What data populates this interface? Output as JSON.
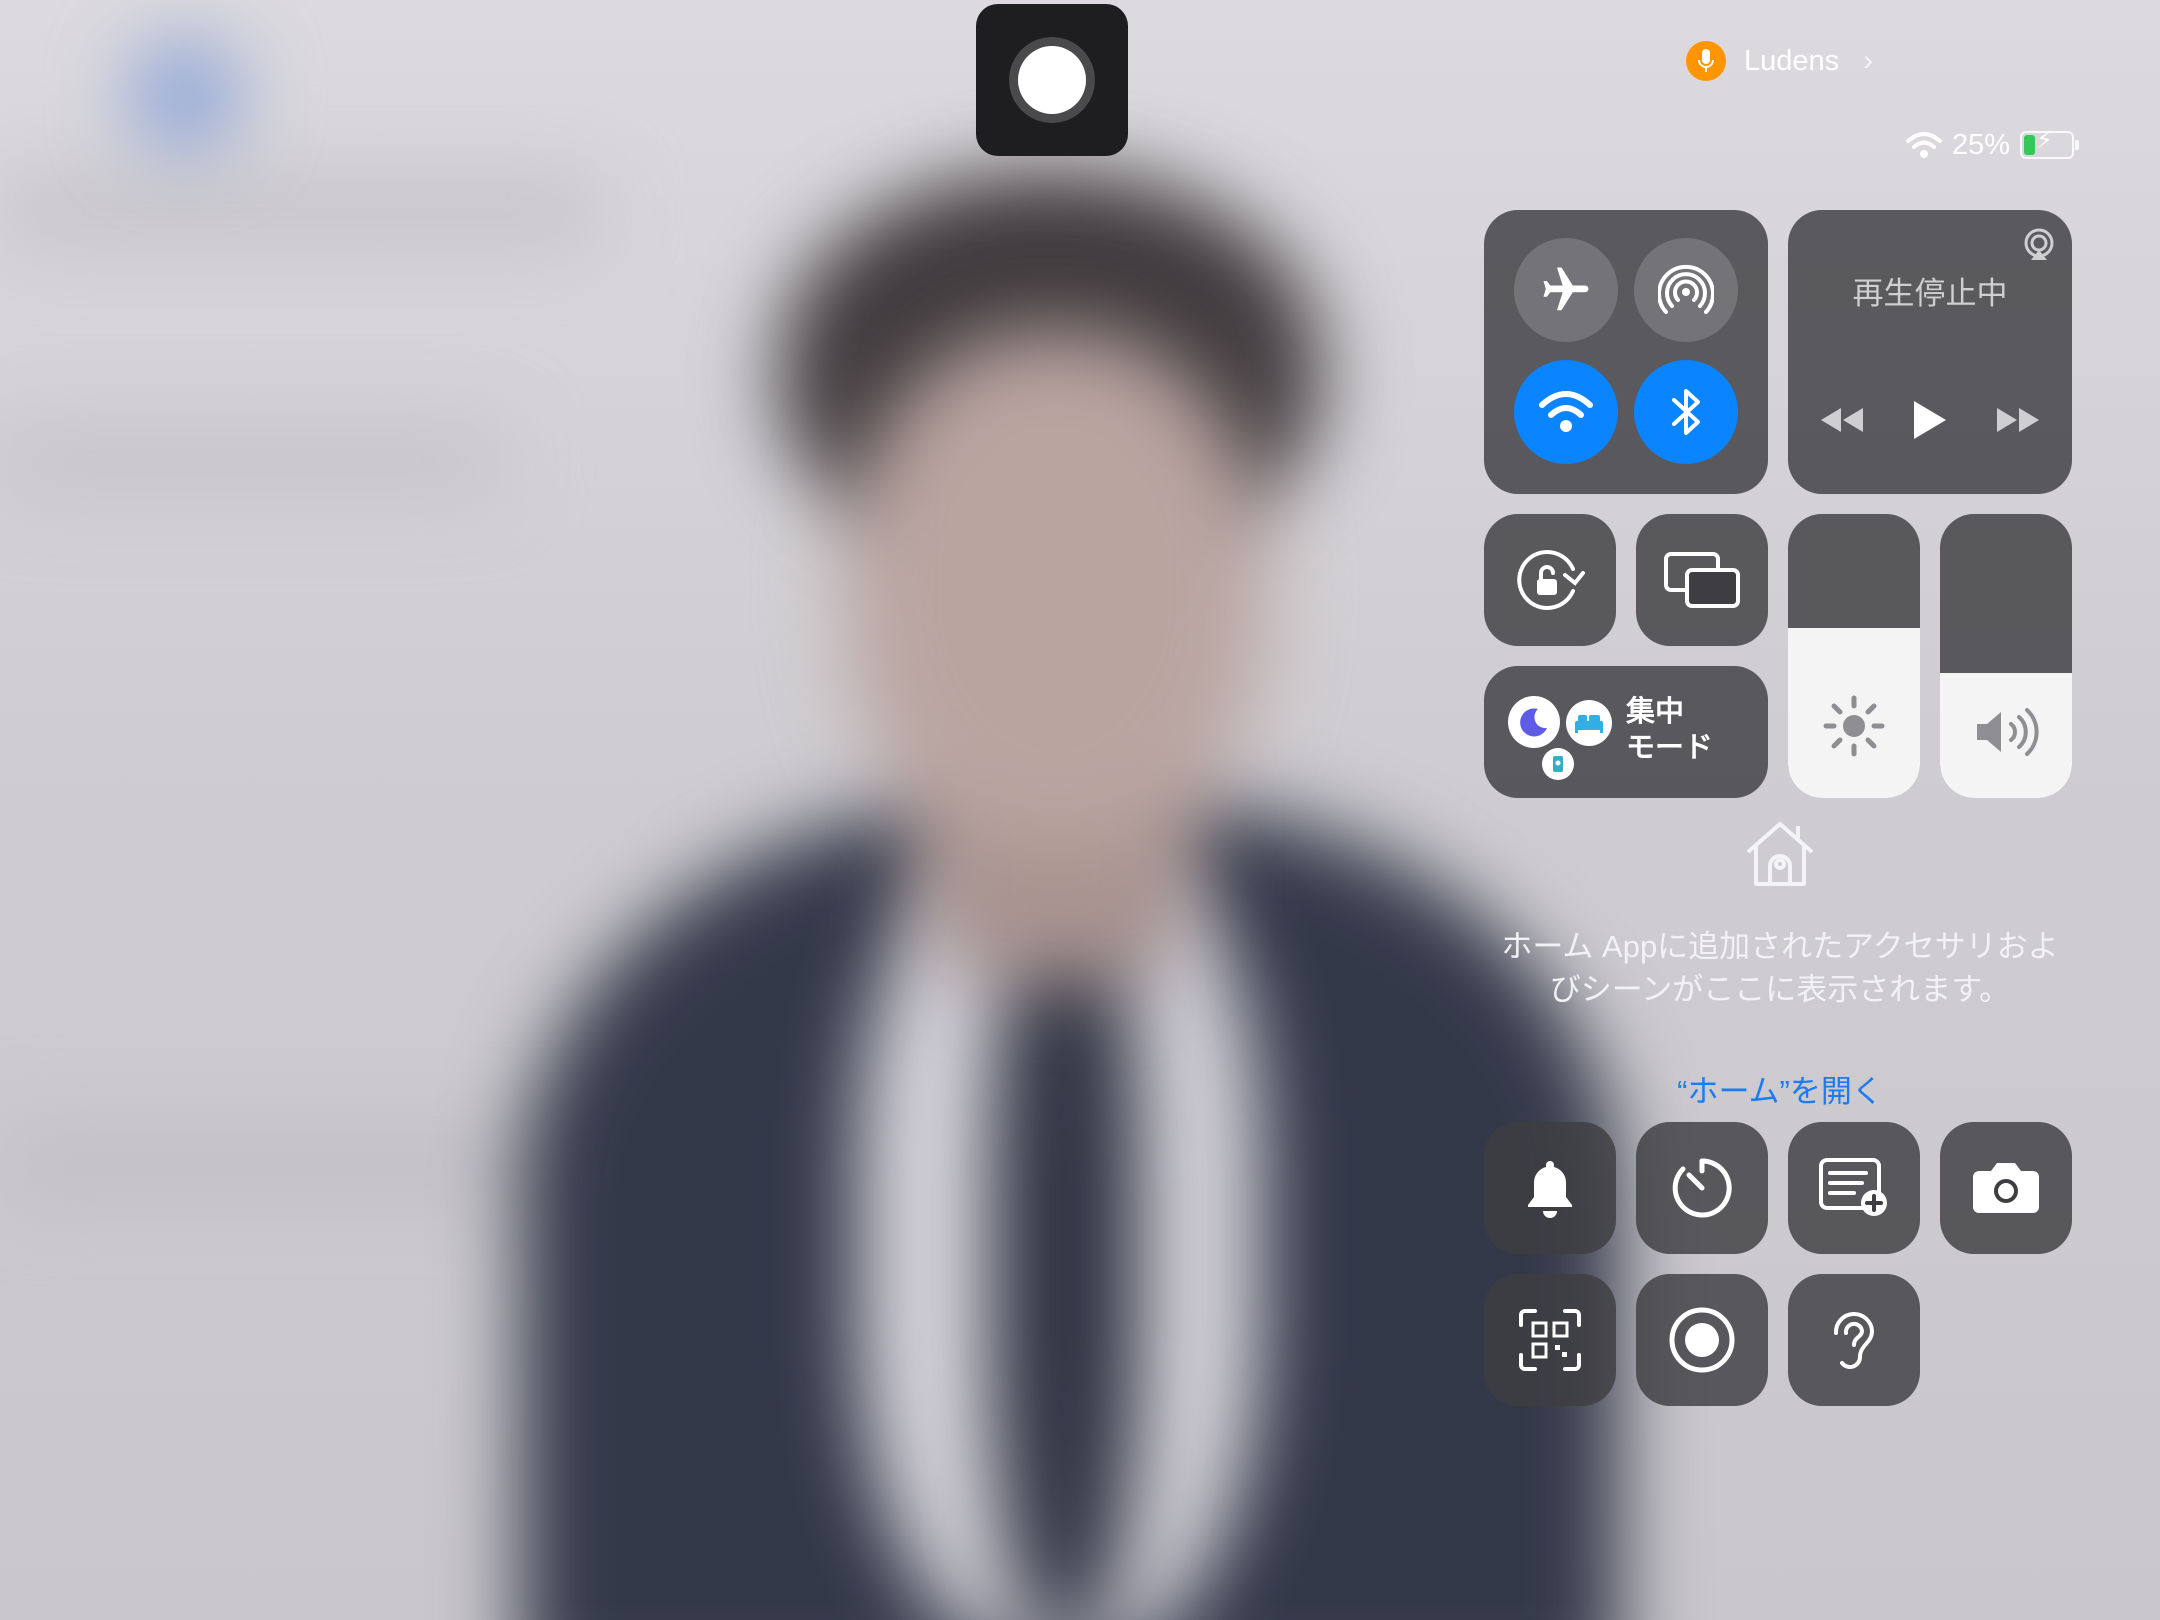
{
  "status_bar": {
    "recording_app": "Ludens",
    "battery_percent": "25%",
    "battery_level": 0.25,
    "battery_charging": true
  },
  "connectivity": {
    "airplane_mode": false,
    "cellular_hotspot": false,
    "wifi": true,
    "bluetooth": true
  },
  "now_playing": {
    "title": "再生停止中"
  },
  "focus": {
    "label_line1": "集中",
    "label_line2": "モード"
  },
  "brightness": {
    "level": 0.6
  },
  "volume": {
    "level": 0.44
  },
  "home": {
    "message": "ホーム Appに追加されたアクセサリおよびシーンがここに表示されます。",
    "link": "“ホーム”を開く"
  },
  "colors": {
    "accent": "#0a84ff",
    "link": "#1a7cf5",
    "recording_badge": "#ff9500",
    "battery_fill": "#34c759"
  },
  "icons": [
    "airplane-icon",
    "hotspot-icon",
    "wifi-icon",
    "bluetooth-icon",
    "airplay-icon",
    "rewind-icon",
    "play-icon",
    "fast-forward-icon",
    "orientation-lock-icon",
    "screen-mirroring-icon",
    "moon-icon",
    "bed-icon",
    "person-icon",
    "brightness-icon",
    "volume-icon",
    "home-icon",
    "bell-icon",
    "timer-icon",
    "quick-note-icon",
    "camera-icon",
    "qr-code-icon",
    "screen-record-icon",
    "hearing-icon"
  ]
}
